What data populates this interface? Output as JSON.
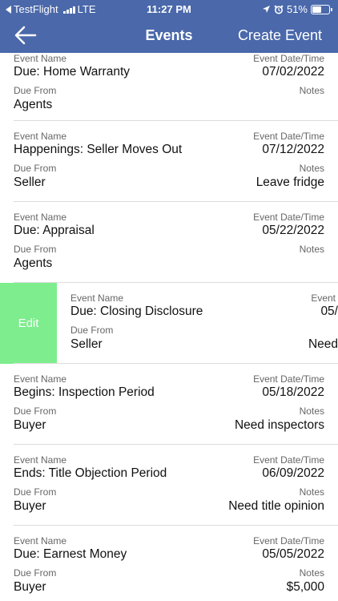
{
  "status": {
    "carrier": "TestFlight",
    "network": "LTE",
    "time": "11:27 PM",
    "battery": "51%"
  },
  "nav": {
    "title": "Events",
    "create_label": "Create Event"
  },
  "labels": {
    "event_name": "Event Name",
    "event_date": "Event Date/Time",
    "due_from": "Due From",
    "notes": "Notes",
    "edit": "Edit"
  },
  "events": [
    {
      "name": "Due: Home Warranty",
      "date": "07/02/2022",
      "due_from": "Agents",
      "notes": ""
    },
    {
      "name": "Happenings: Seller Moves Out",
      "date": "07/12/2022",
      "due_from": "Seller",
      "notes": "Leave fridge"
    },
    {
      "name": "Due: Appraisal",
      "date": "05/22/2022",
      "due_from": "Agents",
      "notes": ""
    },
    {
      "name": "Due: Closing Disclosure",
      "date": "05/",
      "date_label": "Event",
      "due_from": "Seller",
      "notes": "Need"
    },
    {
      "name": "Begins: Inspection Period",
      "date": "05/18/2022",
      "due_from": "Buyer",
      "notes": "Need inspectors"
    },
    {
      "name": "Ends: Title Objection Period",
      "date": "06/09/2022",
      "due_from": "Buyer",
      "notes": "Need title opinion"
    },
    {
      "name": "Due: Earnest Money",
      "date": "05/05/2022",
      "due_from": "Buyer",
      "notes": "$5,000"
    }
  ]
}
